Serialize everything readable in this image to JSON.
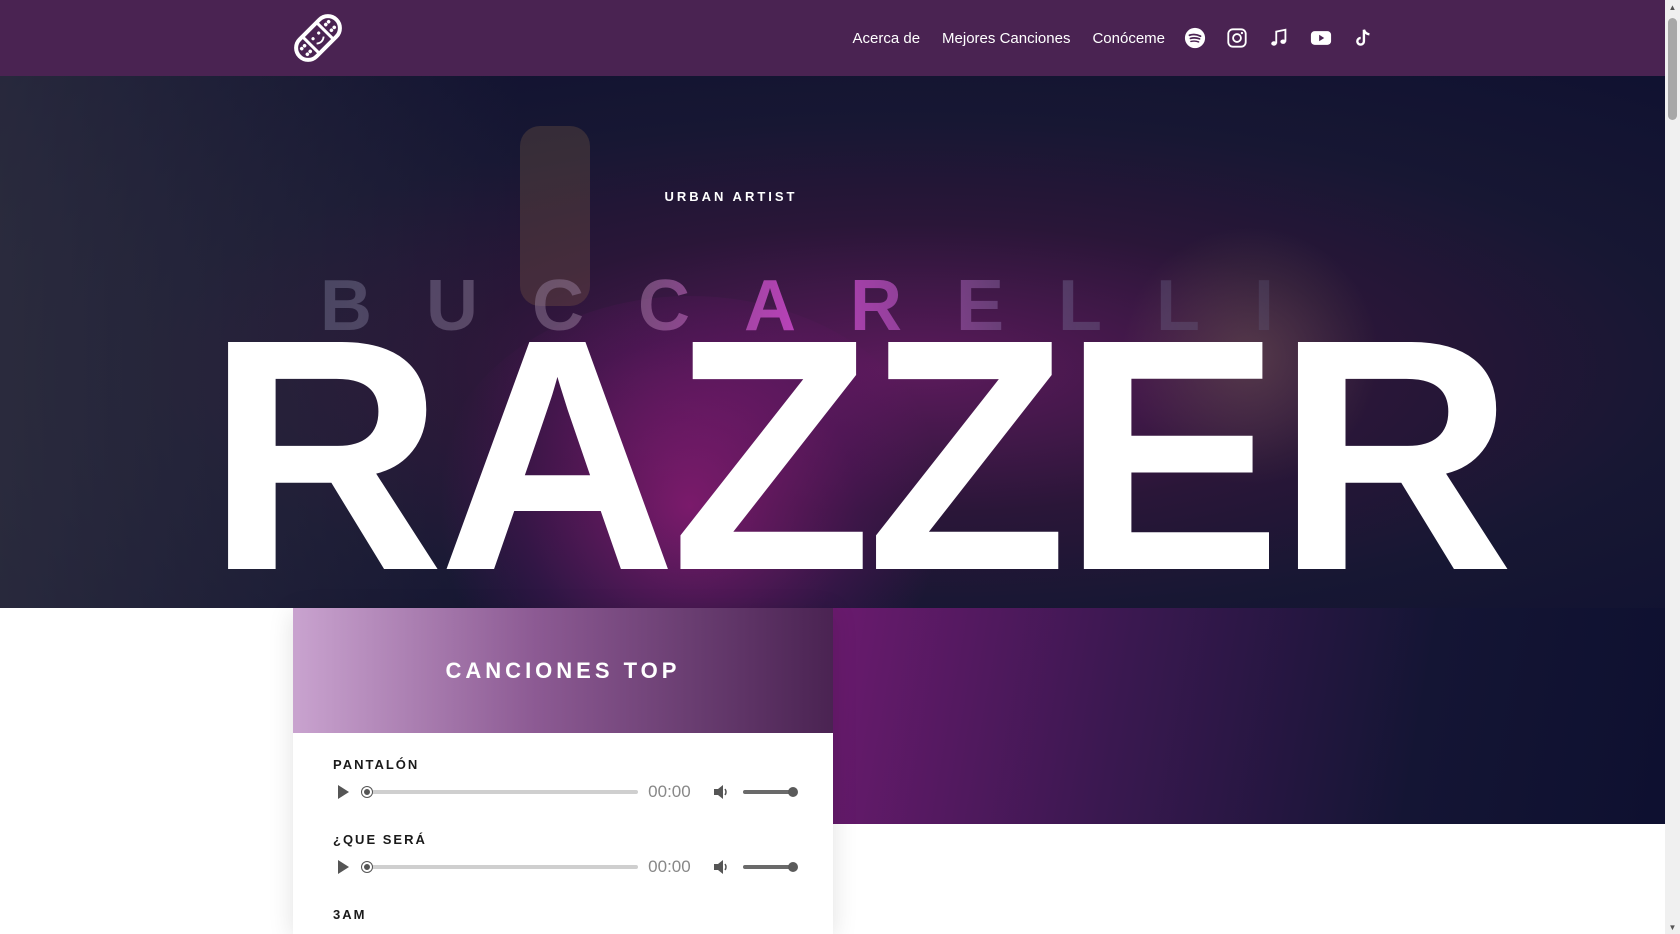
{
  "nav": {
    "logo_icon": "bandage-icon",
    "links": [
      "Acerca de",
      "Mejores Canciones",
      "Conóceme"
    ],
    "social_icons": [
      "spotify-icon",
      "instagram-icon",
      "music-note-icon",
      "youtube-icon",
      "tiktok-icon"
    ]
  },
  "hero": {
    "subtitle": "URBAN ARTIST",
    "ghost_text": "BUCCARELLI",
    "title": "RAZZER"
  },
  "songs_card": {
    "title": "CANCIONES TOP",
    "songs": [
      {
        "name": "PANTALÓN",
        "time": "00:00"
      },
      {
        "name": "¿QUE SERÁ",
        "time": "00:00"
      },
      {
        "name": "3AM",
        "time": ""
      }
    ]
  },
  "colors": {
    "nav_bg": "#4a2352",
    "accent": "#c9a3cf"
  }
}
